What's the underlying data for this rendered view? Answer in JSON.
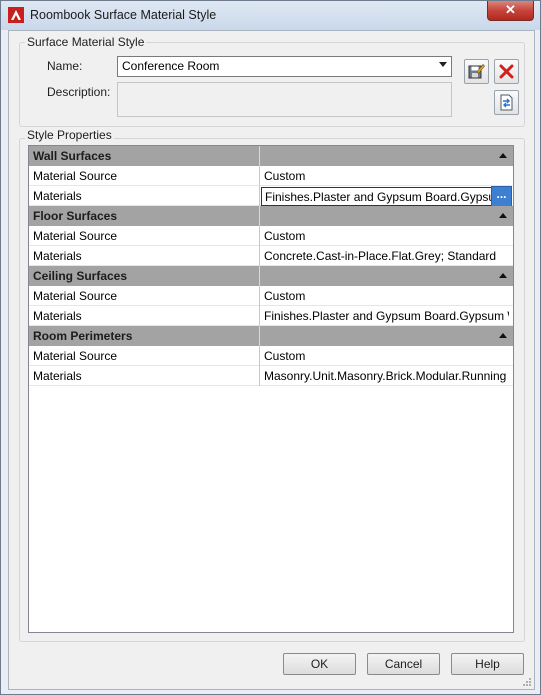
{
  "window": {
    "title": "Roombook Surface Material Style"
  },
  "surface_group": {
    "label": "Surface Material Style",
    "name_label": "Name:",
    "name_value": "Conference Room",
    "description_label": "Description:",
    "description_value": ""
  },
  "properties_group": {
    "label": "Style Properties",
    "categories": [
      {
        "name": "Wall Surfaces",
        "rows": [
          {
            "name": "Material Source",
            "value": "Custom"
          },
          {
            "name": "Materials",
            "value": "Finishes.Plaster and Gypsum Board.Gypsum"
          }
        ]
      },
      {
        "name": "Floor Surfaces",
        "rows": [
          {
            "name": "Material Source",
            "value": "Custom"
          },
          {
            "name": "Materials",
            "value": "Concrete.Cast-in-Place.Flat.Grey; Standard"
          }
        ]
      },
      {
        "name": "Ceiling Surfaces",
        "rows": [
          {
            "name": "Material Source",
            "value": "Custom"
          },
          {
            "name": "Materials",
            "value": "Finishes.Plaster and Gypsum Board.Gypsum W"
          }
        ]
      },
      {
        "name": "Room Perimeters",
        "rows": [
          {
            "name": "Material Source",
            "value": "Custom"
          },
          {
            "name": "Materials",
            "value": "Masonry.Unit.Masonry.Brick.Modular.Running"
          }
        ]
      }
    ],
    "ellipsis_label": "..."
  },
  "buttons": {
    "ok": "OK",
    "cancel": "Cancel",
    "help": "Help",
    "close": "✕"
  },
  "icons": {
    "app": "autocad-logo-icon",
    "save": "save-edit-icon",
    "delete": "delete-icon",
    "import": "import-export-icon"
  },
  "colors": {
    "category_bg": "#a3a3a3",
    "accent": "#3d7fd0",
    "close": "#c7443a",
    "delete_red": "#d2211d"
  }
}
